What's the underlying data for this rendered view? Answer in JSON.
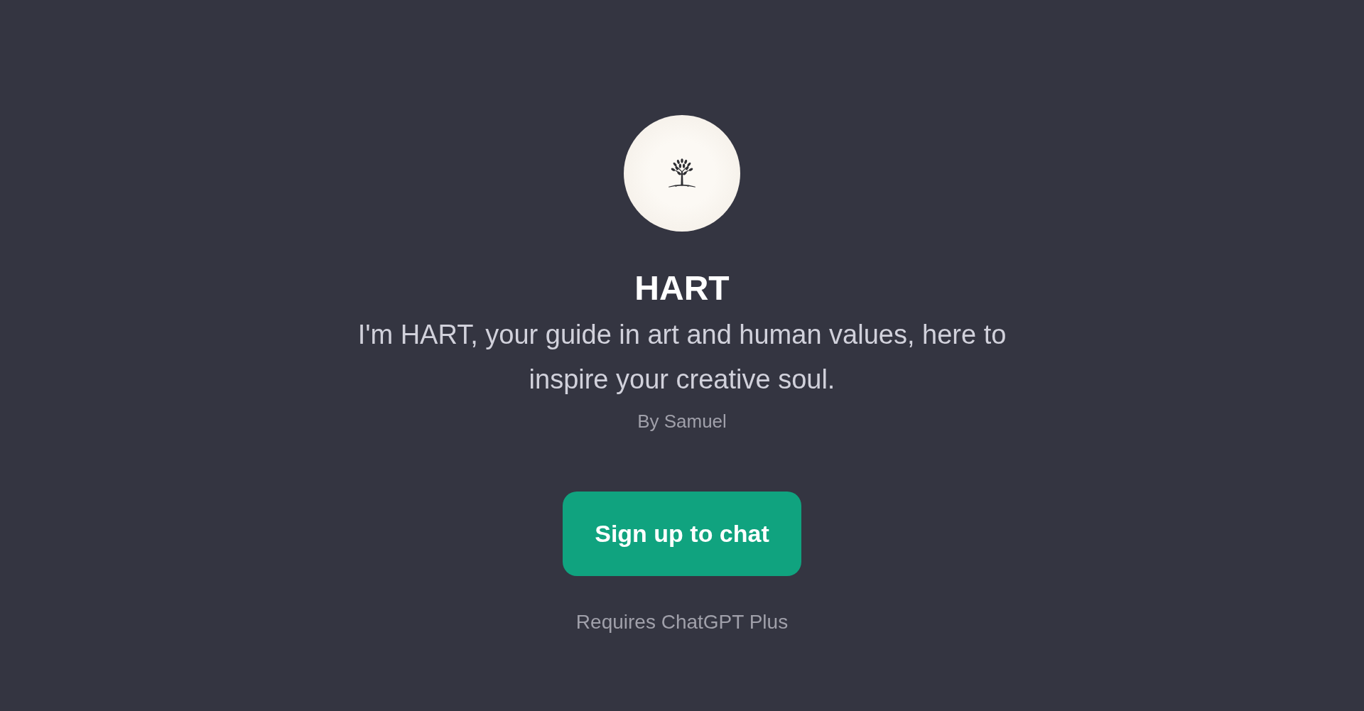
{
  "profile": {
    "title": "HART",
    "description": "I'm HART, your guide in art and human values, here to inspire your creative soul.",
    "author": "By Samuel"
  },
  "button": {
    "label": "Sign up to chat"
  },
  "note": "Requires ChatGPT Plus"
}
